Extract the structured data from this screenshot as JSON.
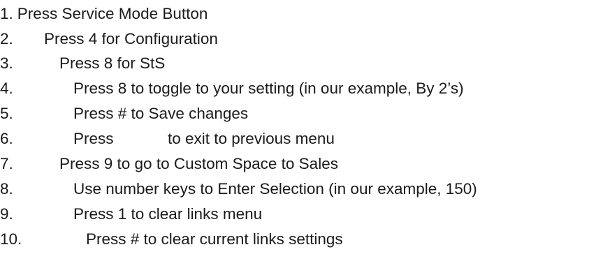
{
  "steps": [
    {
      "number": "1.",
      "text": "Press Service Mode Button"
    },
    {
      "number": "2.",
      "text": "Press 4 for Configuration"
    },
    {
      "number": "3.",
      "text": "Press 8 for StS"
    },
    {
      "number": "4.",
      "text": "Press 8 to toggle to your setting (in our example, By 2’s)"
    },
    {
      "number": "5.",
      "text": "Press # to Save changes"
    },
    {
      "number": "6.",
      "text_before": "Press",
      "text_after": "to exit to previous menu"
    },
    {
      "number": "7.",
      "text": "Press 9 to go to Custom Space to Sales"
    },
    {
      "number": "8.",
      "text": "Use number keys to Enter Selection (in our example, 150)"
    },
    {
      "number": "9.",
      "text": "Press 1 to clear links menu"
    },
    {
      "number": "10.",
      "text": "Press # to clear current links settings"
    }
  ]
}
